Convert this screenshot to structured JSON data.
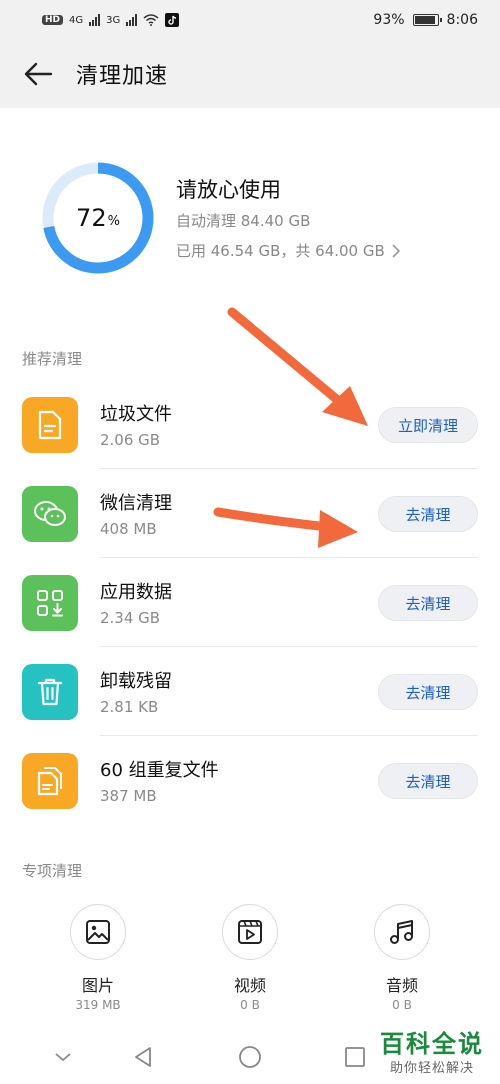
{
  "statusbar": {
    "left_chip": "HD",
    "net1": "4G",
    "net2": "3G",
    "battery_pct": "93%",
    "battery_level": 0.93,
    "time": "8:06"
  },
  "header": {
    "title": "清理加速",
    "back_icon": "arrow-left-icon"
  },
  "summary": {
    "percent": "72",
    "percent_unit": "%",
    "used_fraction": 0.72,
    "ring_color": "#3d9af2",
    "ring_track_color": "#dcebfa",
    "title": "请放心使用",
    "auto_clean": "自动清理 84.40 GB",
    "storage": "已用 46.54 GB，共 64.00 GB"
  },
  "recommended": {
    "label": "推荐清理",
    "items": [
      {
        "name": "垃圾文件",
        "size": "2.06 GB",
        "button": "立即清理",
        "icon": "document-icon",
        "color": "#f9a825"
      },
      {
        "name": "微信清理",
        "size": "408 MB",
        "button": "去清理",
        "icon": "wechat-icon",
        "color": "#5cc15a"
      },
      {
        "name": "应用数据",
        "size": "2.34 GB",
        "button": "去清理",
        "icon": "apps-grid-icon",
        "color": "#5cc15a"
      },
      {
        "name": "卸载残留",
        "size": "2.81 KB",
        "button": "去清理",
        "icon": "trash-icon",
        "color": "#26c2c2"
      },
      {
        "name": "60 组重复文件",
        "size": "387 MB",
        "button": "去清理",
        "icon": "duplicate-files-icon",
        "color": "#f9a825"
      }
    ]
  },
  "special": {
    "label": "专项清理",
    "items": [
      {
        "name": "图片",
        "size": "319 MB",
        "icon": "image-icon"
      },
      {
        "name": "视频",
        "size": "0 B",
        "icon": "video-icon"
      },
      {
        "name": "音频",
        "size": "0 B",
        "icon": "music-note-icon"
      }
    ]
  },
  "watermark": {
    "title": "百科全说",
    "subtitle": "助你轻松解决"
  },
  "annotation_color": "#f26a3b"
}
